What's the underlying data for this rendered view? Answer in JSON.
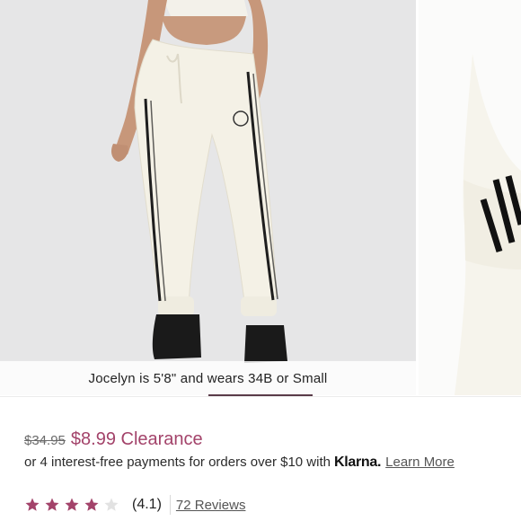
{
  "gallery": {
    "caption": "Jocelyn is 5'8\" and wears 34B or Small",
    "main_image": "model-wearing-cream-joggers-photo",
    "next_image": "jogger-cuff-detail-photo"
  },
  "price": {
    "original": "$34.95",
    "sale": "$8.99 Clearance"
  },
  "payment": {
    "text": "or 4 interest-free payments for orders over $10 with",
    "provider": "Klarna.",
    "link": "Learn More"
  },
  "rating": {
    "value": 4.1,
    "stars_filled": 4,
    "stars_total": 5,
    "score_label": "(4.1)",
    "reviews_label": "72 Reviews"
  },
  "colors": {
    "accent": "#a3436a",
    "indicator": "#5a3b49",
    "star_filled": "#a3436a",
    "star_empty": "#e2e2e2"
  }
}
